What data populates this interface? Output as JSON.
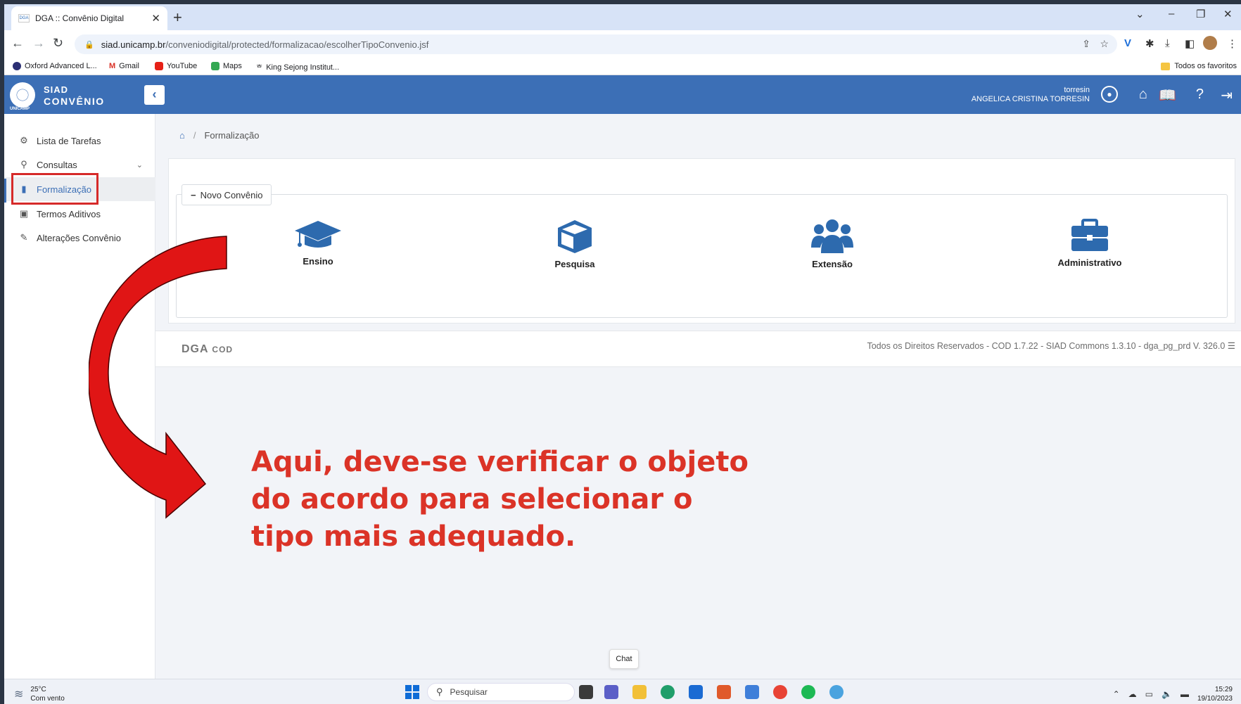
{
  "browser": {
    "tab_title": "DGA :: Convênio Digital",
    "tab_favicon": "DGA",
    "new_tab": "+",
    "url_host": "siad.unicamp.br",
    "url_path": "/conveniodigital/protected/formalizacao/escolherTipoConvenio.jsf",
    "bookmarks": [
      "Oxford Advanced L...",
      "Gmail",
      "YouTube",
      "Maps",
      "King Sejong Institut..."
    ],
    "all_bookmarks": "Todos os favoritos"
  },
  "app": {
    "brand_line1": "SIAD",
    "brand_line2": "CONVÊNIO",
    "logo_caption": "UNICAMP",
    "username": "torresin",
    "fullname": "ANGELICA CRISTINA TORRESIN",
    "accent_color": "#3c6fb6"
  },
  "sidebar": {
    "items": [
      {
        "label": "Lista de Tarefas",
        "icon": "gear-icon"
      },
      {
        "label": "Consultas",
        "icon": "search-icon"
      },
      {
        "label": "Formalização",
        "icon": "document-icon"
      },
      {
        "label": "Termos Aditivos",
        "icon": "calendar-plus-icon"
      },
      {
        "label": "Alterações Convênio",
        "icon": "edit-icon"
      }
    ]
  },
  "breadcrumb": {
    "current": "Formalização"
  },
  "novo_convenio": {
    "legend": "Novo Convênio",
    "options": [
      {
        "label": "Ensino",
        "icon": "graduation-cap-icon"
      },
      {
        "label": "Pesquisa",
        "icon": "cube-icon"
      },
      {
        "label": "Extensão",
        "icon": "users-icon"
      },
      {
        "label": "Administrativo",
        "icon": "briefcase-icon"
      }
    ]
  },
  "footer": {
    "brand": "DGA",
    "brand_small": "COD",
    "rights": "Todos os Direitos Reservados - COD 1.7.22 - SIAD Commons 1.3.10 - dga_pg_prd V. 326.0"
  },
  "annotation": {
    "line1": "Aqui, deve-se verificar o objeto",
    "line2": "do acordo para selecionar o",
    "line3": "tipo mais adequado.",
    "color": "#db3327"
  },
  "taskbar": {
    "temperature": "25°C",
    "weather": "Com vento",
    "search_placeholder": "Pesquisar",
    "chat_tooltip": "Chat",
    "time": "15:29",
    "date": "19/10/2023"
  }
}
